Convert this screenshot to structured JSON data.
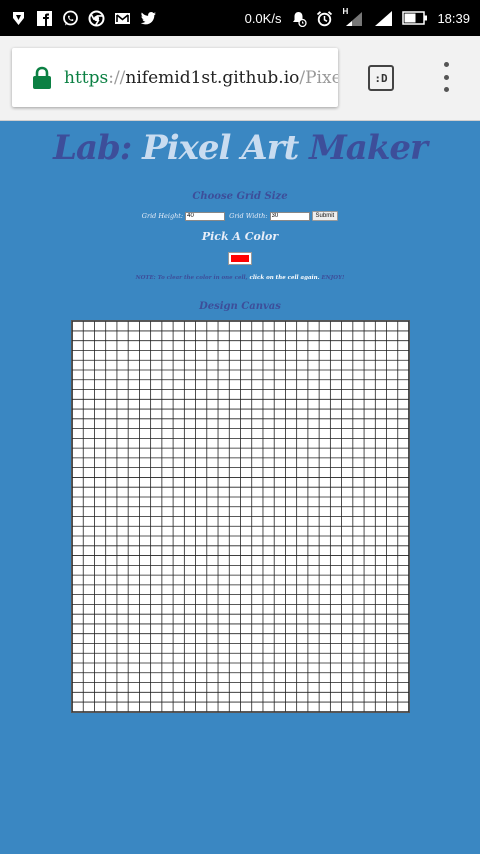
{
  "status_bar": {
    "left_icons": [
      "vpn-icon",
      "facebook-icon",
      "whatsapp-icon",
      "chrome-icon",
      "gmail-icon",
      "twitter-icon"
    ],
    "net_speed": "0.0K/s",
    "right_icons": [
      "alarm-notification-icon",
      "alarm-clock-icon",
      "signal-h-icon",
      "signal-icon",
      "battery-icon"
    ],
    "signal_badge": "H",
    "time": "18:39"
  },
  "browser": {
    "url_scheme": "https",
    "url_sep": "://",
    "url_host": "nifemid1st.github.io",
    "url_path": "/PixelA",
    "tab_label": ":D"
  },
  "page": {
    "title_part1": "Lab:",
    "title_part2": "Pixel Art",
    "title_part3": "Maker",
    "grid_heading": "Choose Grid Size",
    "height_label": "Grid Height:",
    "height_value": "40",
    "width_label": "Grid Width:",
    "width_value": "30",
    "submit_label": "Submit",
    "color_heading": "Pick A Color",
    "color_value": "#ff0000",
    "note_prefix": "NOTE: To clear the color in one cell,",
    "note_highlight": "click on the cell again.",
    "note_suffix": "ENJOY!",
    "canvas_heading": "Design Canvas",
    "grid_rows": 40,
    "grid_cols": 30
  },
  "colors": {
    "page_bg": "#3a87c2",
    "heading_dark": "#3d4e9a",
    "heading_light": "#c9dcf0",
    "url_https": "#0b8043"
  }
}
